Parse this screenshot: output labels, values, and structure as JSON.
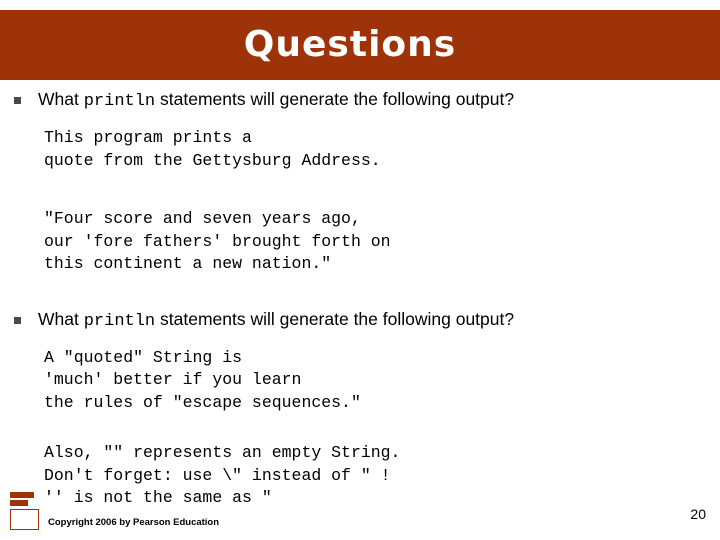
{
  "slide": {
    "title": "Questions",
    "title_bar_color": "#9e3209",
    "page_number": "20",
    "copyright": "Copyright 2006 by Pearson Education",
    "bullets": [
      {
        "text_before": "What ",
        "code_word": "println",
        "text_after": " statements will generate the following output?",
        "outputs": [
          "This program prints a\nquote from the Gettysburg Address.",
          "\"Four score and seven years ago,\nour 'fore fathers' brought forth on\nthis continent a new nation.\""
        ]
      },
      {
        "text_before": "What ",
        "code_word": "println",
        "text_after": " statements will generate the following output?",
        "outputs": [
          "A \"quoted\" String is\n'much' better if you learn\nthe rules of \"escape sequences.\"",
          "Also, \"\" represents an empty String.\nDon't forget: use \\\" instead of \" !\n'' is not the same as \""
        ]
      }
    ]
  }
}
